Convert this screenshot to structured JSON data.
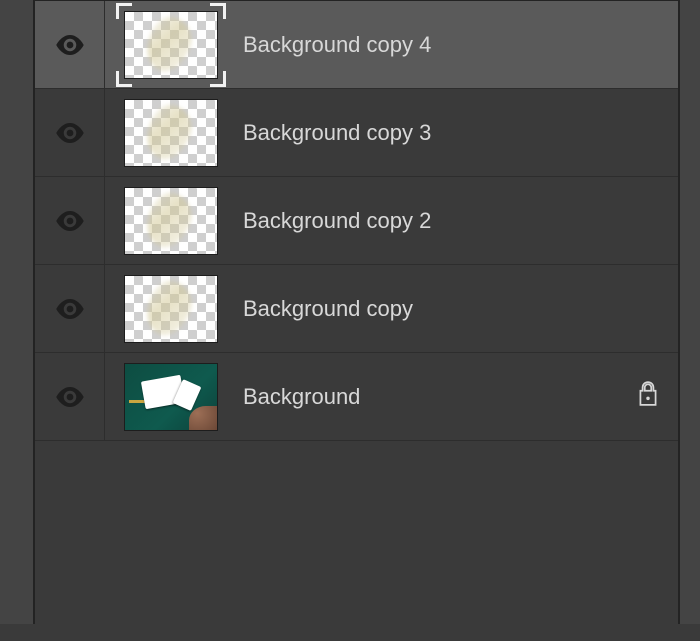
{
  "layers": [
    {
      "name": "Background copy 4",
      "visible": true,
      "selected": true,
      "thumb_type": "transparency",
      "locked": false
    },
    {
      "name": "Background copy 3",
      "visible": true,
      "selected": false,
      "thumb_type": "transparency",
      "locked": false
    },
    {
      "name": "Background copy 2",
      "visible": true,
      "selected": false,
      "thumb_type": "transparency",
      "locked": false
    },
    {
      "name": "Background copy",
      "visible": true,
      "selected": false,
      "thumb_type": "transparency",
      "locked": false
    },
    {
      "name": "Background",
      "visible": true,
      "selected": false,
      "thumb_type": "image",
      "locked": true
    }
  ]
}
